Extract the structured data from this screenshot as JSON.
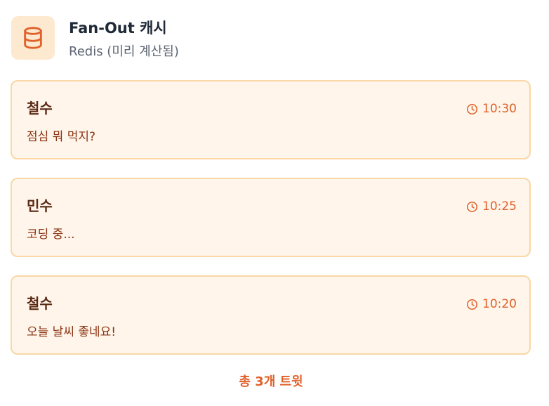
{
  "header": {
    "title": "Fan-Out 캐시",
    "subtitle": "Redis (미리 계산됨)",
    "icon": "database-icon"
  },
  "tweets": [
    {
      "author": "철수",
      "time": "10:30",
      "content": "점심 뭐 먹지?"
    },
    {
      "author": "민수",
      "time": "10:25",
      "content": "코딩 중..."
    },
    {
      "author": "철수",
      "time": "10:20",
      "content": "오늘 날씨 좋네요!"
    }
  ],
  "footer": {
    "total_label": "총 3개 트윗"
  },
  "colors": {
    "accent": "#e0612a",
    "card_background": "#fff5ea",
    "card_border": "#f9d7a6",
    "icon_background": "#fde9cf"
  }
}
